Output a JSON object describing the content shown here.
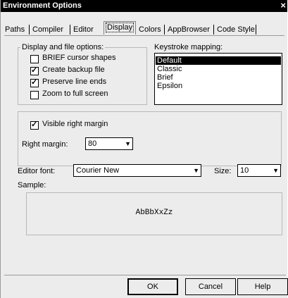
{
  "window": {
    "title": "Environment Options",
    "close_glyph": "×"
  },
  "tabs": [
    {
      "label": "Paths"
    },
    {
      "label": "Compiler"
    },
    {
      "label": "Editor"
    },
    {
      "label": "Display",
      "selected": true
    },
    {
      "label": "Colors"
    },
    {
      "label": "AppBrowser"
    },
    {
      "label": "Code Style"
    }
  ],
  "display_options": {
    "label": "Display and file options:",
    "items": [
      {
        "label": "BRIEF cursor shapes",
        "checked": false
      },
      {
        "label": "Create backup file",
        "checked": true
      },
      {
        "label": "Preserve line ends",
        "checked": true
      },
      {
        "label": "Zoom to full screen",
        "checked": false
      }
    ]
  },
  "keystroke": {
    "label": "Keystroke mapping:",
    "items": [
      "Default",
      "Classic",
      "Brief",
      "Epsilon"
    ],
    "selected": "Default"
  },
  "margin": {
    "visible_label": "Visible right margin",
    "visible_checked": true,
    "right_margin_label": "Right margin:",
    "right_margin_value": "80"
  },
  "editor_font": {
    "label": "Editor font:",
    "value": "Courier New"
  },
  "size": {
    "label": "Size:",
    "value": "10"
  },
  "sample": {
    "label": "Sample:",
    "text": "AbBbXxZz"
  },
  "buttons": {
    "ok": "OK",
    "cancel": "Cancel",
    "help": "Help"
  },
  "check_mark": "✓",
  "arrow_glyph": "▼"
}
